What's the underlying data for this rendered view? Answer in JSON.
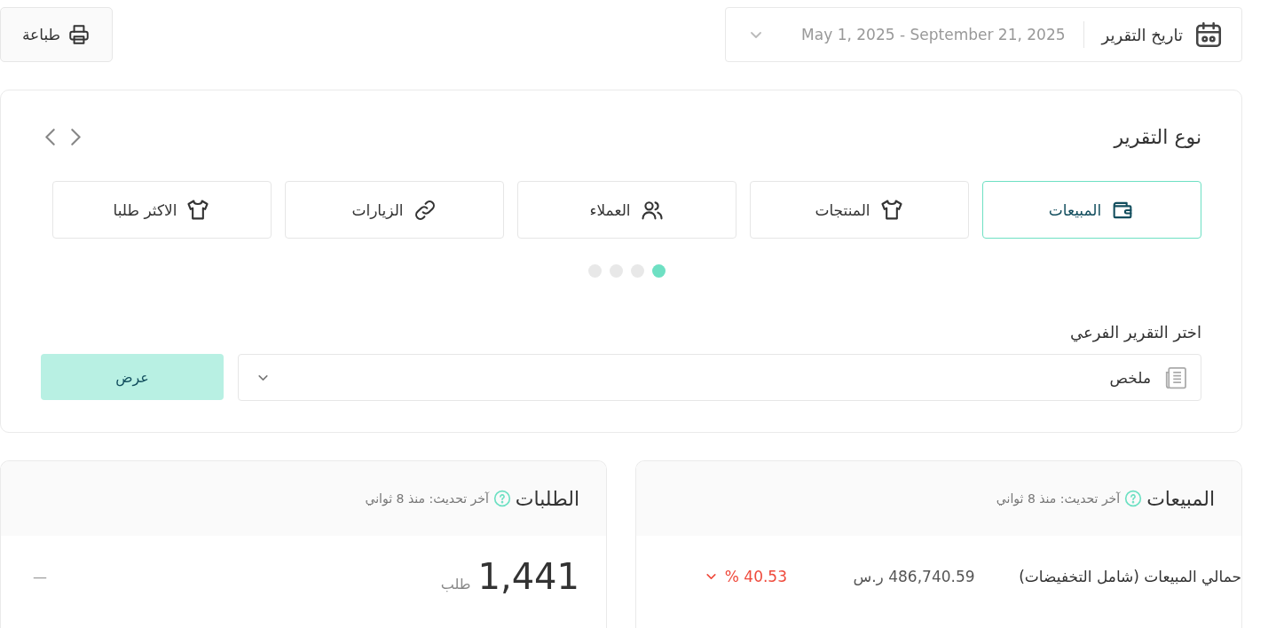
{
  "date_filter": {
    "label": "تاريخ التقرير",
    "value": "May 1, 2025 - September 21, 2025"
  },
  "print_button": {
    "label": "طباعة"
  },
  "report_type": {
    "title": "نوع التقرير",
    "tabs": [
      {
        "label": "المبيعات",
        "kind": "wallet",
        "selected": true
      },
      {
        "label": "المنتجات",
        "kind": "shirt",
        "selected": false
      },
      {
        "label": "العملاء",
        "kind": "users",
        "selected": false
      },
      {
        "label": "الزيارات",
        "kind": "link",
        "selected": false
      },
      {
        "label": "الاكثر طلبا",
        "kind": "shirt",
        "selected": false
      }
    ],
    "pages": [
      {
        "selected": true
      },
      {
        "selected": false
      },
      {
        "selected": false
      },
      {
        "selected": false
      }
    ]
  },
  "sub_report": {
    "label": "اختر التقرير الفرعي",
    "value": "ملخص",
    "button": "عرض"
  },
  "cards": [
    {
      "kind": "table",
      "title": "المبيعات",
      "updated": "آخر تحديث: منذ 8 ثواني",
      "label": "حمالي المبيعات (شامل التخفيضات)",
      "value": "486,740.59",
      "unit": "ر.س",
      "change": "40.53 %",
      "falling": true
    },
    {
      "kind": "metric",
      "title": "الطلبات",
      "updated": "آخر تحديث: منذ 8 ثواني",
      "value": "1,441",
      "unit": "طلب",
      "change": "—"
    }
  ]
}
